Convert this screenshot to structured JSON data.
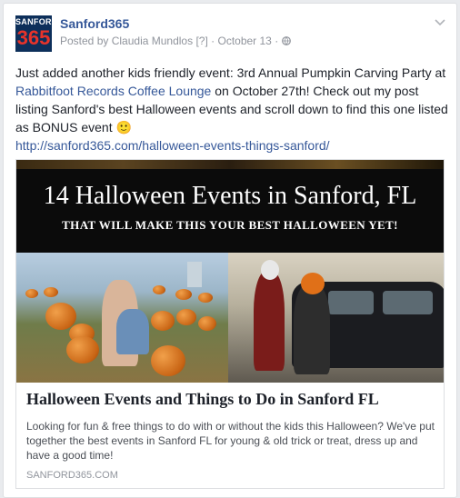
{
  "page": {
    "logo_top": "SANFORD",
    "logo_num": "365",
    "name": "Sanford365",
    "posted_by_prefix": "Posted by",
    "author": "Claudia Mundlos",
    "author_badge": "[?]",
    "separator": "·",
    "date": "October 13",
    "separator2": "·",
    "privacy_icon": "globe-icon",
    "chevron_icon": "chevron-down-icon"
  },
  "post": {
    "text1": "Just added another kids friendly event: 3rd Annual Pumpkin Carving Party at ",
    "venue_link": "Rabbitfoot Records Coffee Lounge",
    "text2": " on October 27th! Check out my post listing Sanford's best Halloween events and scroll down to find this one listed as BONUS event ",
    "emoji": "🙂",
    "url": "http://sanford365.com/halloween-events-things-sanford/"
  },
  "attachment": {
    "banner_title": "14 Halloween Events in Sanford, FL",
    "banner_subtitle": "THAT WILL MAKE THIS YOUR BEST HALLOWEEN YET!",
    "title": "Halloween Events and Things to Do in Sanford FL",
    "description": "Looking for fun & free things to do with or without the kids this Halloween? We've put together the best events in Sanford FL for young & old trick or treat, dress up and have a good time!",
    "domain": "SANFORD365.COM"
  },
  "colors": {
    "link": "#365899",
    "meta": "#90949c",
    "logo_bg": "#0d2f5a",
    "logo_accent": "#e8332a"
  }
}
